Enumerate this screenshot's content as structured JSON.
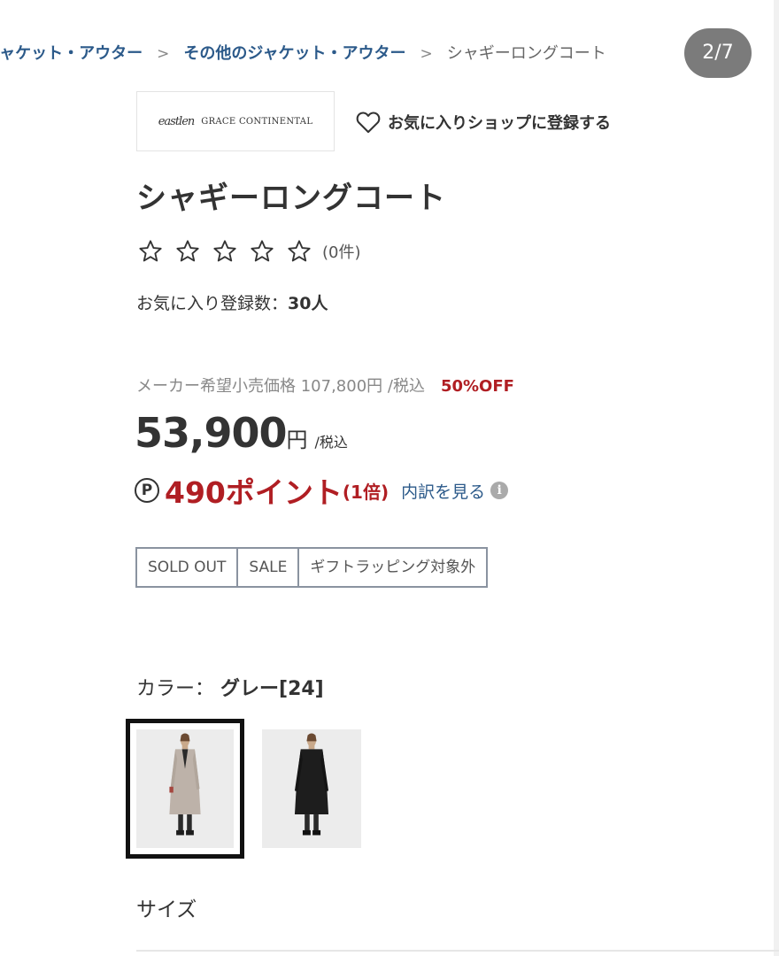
{
  "breadcrumb": {
    "items": [
      "ジャケット・アウター",
      "その他のジャケット・アウター"
    ],
    "current": "シャギーロングコート",
    "separator": ">"
  },
  "page_counter": "2/7",
  "shop": {
    "logo_mark": "eastlen",
    "logo_text": "GRACE CONTINENTAL",
    "favorite_label": "お気に入りショップに登録する"
  },
  "product": {
    "title": "シャギーロングコート",
    "rating_stars": 0,
    "rating_count": "(0件)",
    "favorites_label": "お気に入り登録数：",
    "favorites_count": "30人"
  },
  "pricing": {
    "list_price": "メーカー希望小売価格 107,800円 /税込",
    "discount": "50%OFF",
    "price": "53,900",
    "currency": "円",
    "tax_note": "/税込",
    "points_icon": "P",
    "points": "490ポイント",
    "points_multiplier": "(1倍)",
    "breakdown_link": "内訳を見る",
    "info_icon": "i"
  },
  "tags": [
    "SOLD OUT",
    "SALE",
    "ギフトラッピング対象外"
  ],
  "color": {
    "label": "カラー：",
    "value": "グレー[24]"
  },
  "size": {
    "label": "サイズ"
  },
  "colors": {
    "link": "#2c5a8a",
    "sale_red": "#b01e23",
    "text": "#333333",
    "counter_bg": "#7b7b7b"
  }
}
